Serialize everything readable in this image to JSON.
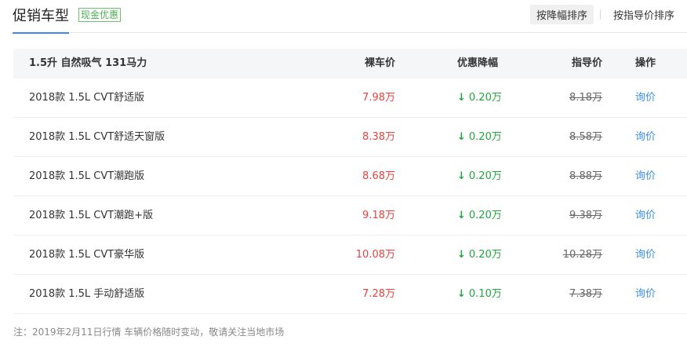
{
  "header": {
    "title": "促销车型",
    "badge": "现金优惠",
    "sort_by_discount": "按降幅排序",
    "sort_by_guide": "按指导价排序"
  },
  "table": {
    "group_title": "1.5升 自然吸气 131马力",
    "columns": [
      "裸车价",
      "优惠降幅",
      "指导价",
      "操作"
    ],
    "rows": [
      {
        "name": "2018款 1.5L CVT舒适版",
        "price": "7.98万",
        "discount": "0.20万",
        "guide": "8.18万",
        "action": "询价"
      },
      {
        "name": "2018款 1.5L CVT舒适天窗版",
        "price": "8.38万",
        "discount": "0.20万",
        "guide": "8.58万",
        "action": "询价"
      },
      {
        "name": "2018款 1.5L CVT潮跑版",
        "price": "8.68万",
        "discount": "0.20万",
        "guide": "8.88万",
        "action": "询价"
      },
      {
        "name": "2018款 1.5L CVT潮跑+版",
        "price": "9.18万",
        "discount": "0.20万",
        "guide": "9.38万",
        "action": "询价"
      },
      {
        "name": "2018款 1.5L CVT豪华版",
        "price": "10.08万",
        "discount": "0.20万",
        "guide": "10.28万",
        "action": "询价"
      },
      {
        "name": "2018款 1.5L 手动舒适版",
        "price": "7.28万",
        "discount": "0.10万",
        "guide": "7.38万",
        "action": "询价"
      }
    ]
  },
  "footer": {
    "note": "注：2019年2月11日行情 车辆价格随时变动，敬请关注当地市场"
  },
  "icons": {
    "discount_arrow": "arrow-down-icon"
  },
  "colors": {
    "accent": "#3a8ee6",
    "price": "#e9423f",
    "discount": "#21a53b",
    "badge": "#4caf50"
  }
}
